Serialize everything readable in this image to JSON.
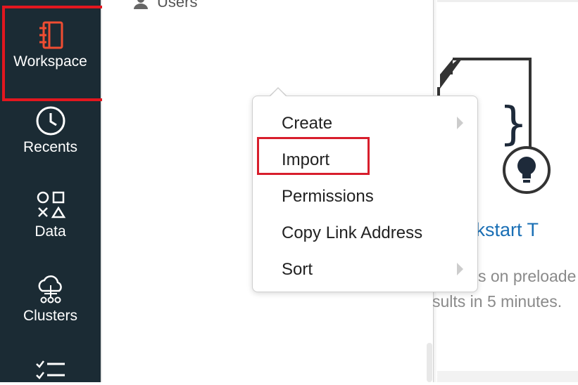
{
  "sidebar": {
    "items": [
      {
        "label": "Workspace",
        "icon": "notebook-icon",
        "active": true
      },
      {
        "label": "Recents",
        "icon": "clock-icon"
      },
      {
        "label": "Data",
        "icon": "shapes-icon"
      },
      {
        "label": "Clusters",
        "icon": "cloud-cluster-icon"
      },
      {
        "label": "",
        "icon": "checklist-icon"
      }
    ],
    "background": "#1b2b34",
    "highlight_color": "#e3171f"
  },
  "panel": {
    "row_label": "Users"
  },
  "context_menu": {
    "items": [
      {
        "label": "Create",
        "submenu": true
      },
      {
        "label": "Import",
        "submenu": false,
        "highlighted": true
      },
      {
        "label": "Permissions",
        "submenu": false
      },
      {
        "label": "Copy Link Address",
        "submenu": false
      },
      {
        "label": "Sort",
        "submenu": true
      }
    ]
  },
  "content": {
    "link": "Quickstart T",
    "desc_line1": "s on preloade",
    "desc_line2": "sults in 5 minutes.",
    "link_color": "#1a6fb5"
  }
}
